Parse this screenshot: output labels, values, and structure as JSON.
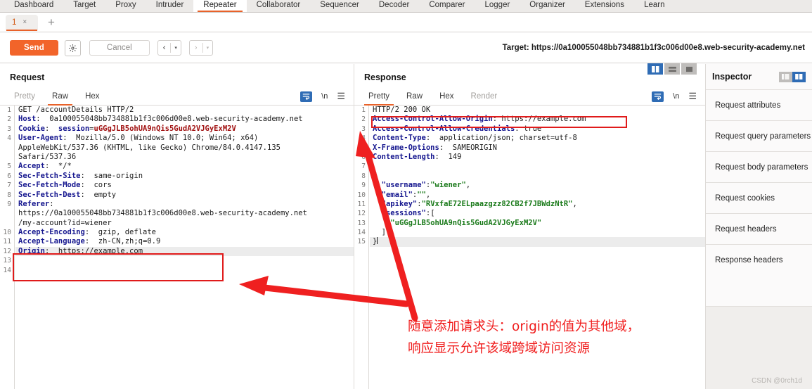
{
  "main_tabs": [
    {
      "label": "Dashboard",
      "active": false
    },
    {
      "label": "Target",
      "active": false
    },
    {
      "label": "Proxy",
      "active": false
    },
    {
      "label": "Intruder",
      "active": false
    },
    {
      "label": "Repeater",
      "active": true
    },
    {
      "label": "Collaborator",
      "active": false
    },
    {
      "label": "Sequencer",
      "active": false
    },
    {
      "label": "Decoder",
      "active": false
    },
    {
      "label": "Comparer",
      "active": false
    },
    {
      "label": "Logger",
      "active": false
    },
    {
      "label": "Organizer",
      "active": false
    },
    {
      "label": "Extensions",
      "active": false
    },
    {
      "label": "Learn",
      "active": false
    }
  ],
  "repeater_tabs": {
    "tab_number": "1",
    "close_glyph": "×",
    "add_glyph": "+"
  },
  "toolbar": {
    "send_label": "Send",
    "cancel_label": "Cancel",
    "gear_icon": "gear-icon",
    "prev_glyph": "‹",
    "next_glyph": "›",
    "caret_glyph": "▾",
    "target_label": "Target: https://0a100055048bb734881b1f3c006d00e8.web-security-academy.net"
  },
  "request": {
    "title": "Request",
    "tabs": [
      {
        "label": "Pretty",
        "active": false,
        "muted": true
      },
      {
        "label": "Raw",
        "active": true,
        "muted": false
      },
      {
        "label": "Hex",
        "active": false,
        "muted": false
      }
    ],
    "actions": {
      "wrap_icon": "wrap-lines-icon",
      "newline_label": "\\n",
      "menu_icon": "hamburger-menu-icon"
    },
    "line_numbers": [
      "1",
      "2",
      "3",
      "4",
      "",
      "",
      "5",
      "6",
      "7",
      "8",
      "9",
      "",
      "",
      "10",
      "11",
      "12",
      "13",
      "14"
    ],
    "lines": [
      {
        "n": 1,
        "parts": [
          {
            "t": "GET /accountDetails HTTP/2",
            "c": "val"
          }
        ]
      },
      {
        "n": 2,
        "parts": [
          {
            "t": "Host",
            "c": "hdr"
          },
          {
            "t": ":  0a100055048bb734881b1f3c006d00e8.web-security-academy.net",
            "c": "val"
          }
        ]
      },
      {
        "n": 3,
        "parts": [
          {
            "t": "Cookie",
            "c": "hdr"
          },
          {
            "t": ":  ",
            "c": "val"
          },
          {
            "t": "session",
            "c": "hdr"
          },
          {
            "t": "=",
            "c": "val"
          },
          {
            "t": "uGGgJLB5ohUA9nQis5GudA2VJGyExM2V",
            "c": "red"
          }
        ]
      },
      {
        "n": 4,
        "parts": [
          {
            "t": "User-Agent",
            "c": "hdr"
          },
          {
            "t": ":  Mozilla/5.0 (Windows NT 10.0; Win64; x64)",
            "c": "val"
          }
        ]
      },
      {
        "n": 0,
        "parts": [
          {
            "t": "AppleWebKit/537.36 (KHTML, like Gecko) Chrome/84.0.4147.135",
            "c": "val"
          }
        ]
      },
      {
        "n": 0,
        "parts": [
          {
            "t": "Safari/537.36",
            "c": "val"
          }
        ]
      },
      {
        "n": 5,
        "parts": [
          {
            "t": "Accept",
            "c": "hdr"
          },
          {
            "t": ":  */*",
            "c": "val"
          }
        ]
      },
      {
        "n": 6,
        "parts": [
          {
            "t": "Sec-Fetch-Site",
            "c": "hdr"
          },
          {
            "t": ":  same-origin",
            "c": "val"
          }
        ]
      },
      {
        "n": 7,
        "parts": [
          {
            "t": "Sec-Fetch-Mode",
            "c": "hdr"
          },
          {
            "t": ":  cors",
            "c": "val"
          }
        ]
      },
      {
        "n": 8,
        "parts": [
          {
            "t": "Sec-Fetch-Dest",
            "c": "hdr"
          },
          {
            "t": ":  empty",
            "c": "val"
          }
        ]
      },
      {
        "n": 9,
        "parts": [
          {
            "t": "Referer",
            "c": "hdr"
          },
          {
            "t": ":",
            "c": "val"
          }
        ]
      },
      {
        "n": 0,
        "parts": [
          {
            "t": "https://0a100055048bb734881b1f3c006d00e8.web-security-academy.net",
            "c": "val"
          }
        ]
      },
      {
        "n": 0,
        "parts": [
          {
            "t": "/my-account?id=wiener",
            "c": "val"
          }
        ]
      },
      {
        "n": 10,
        "parts": [
          {
            "t": "Accept-Encoding",
            "c": "hdr"
          },
          {
            "t": ":  gzip, deflate",
            "c": "val"
          }
        ]
      },
      {
        "n": 11,
        "parts": [
          {
            "t": "Accept-Language",
            "c": "hdr"
          },
          {
            "t": ":  zh-CN,zh;q=0.9",
            "c": "val"
          }
        ]
      },
      {
        "n": 12,
        "hl": true,
        "parts": [
          {
            "t": "Origin",
            "c": "hdr"
          },
          {
            "t": ":  https://example.com",
            "c": "val"
          }
        ]
      },
      {
        "n": 13,
        "parts": [
          {
            "t": "",
            "c": "val"
          }
        ]
      },
      {
        "n": 14,
        "parts": [
          {
            "t": "",
            "c": "val"
          }
        ]
      }
    ]
  },
  "response": {
    "title": "Response",
    "tabs": [
      {
        "label": "Pretty",
        "active": true,
        "muted": false
      },
      {
        "label": "Raw",
        "active": false,
        "muted": false
      },
      {
        "label": "Hex",
        "active": false,
        "muted": false
      },
      {
        "label": "Render",
        "active": false,
        "muted": true
      }
    ],
    "actions": {
      "wrap_icon": "wrap-lines-icon",
      "newline_label": "\\n",
      "menu_icon": "hamburger-menu-icon"
    },
    "layout_buttons": [
      "split-vertical-layout-icon",
      "split-horizontal-layout-icon",
      "single-pane-layout-icon"
    ],
    "lines": [
      {
        "n": 1,
        "parts": [
          {
            "t": "HTTP/2 200 OK",
            "c": "val"
          }
        ]
      },
      {
        "n": 2,
        "parts": [
          {
            "t": "Access-Control-Allow-Origin",
            "c": "hdr"
          },
          {
            "t": ": https://example.com",
            "c": "val"
          }
        ]
      },
      {
        "n": 3,
        "parts": [
          {
            "t": "Access-Control-Allow-Credentials",
            "c": "hdr"
          },
          {
            "t": ": true",
            "c": "val"
          }
        ]
      },
      {
        "n": 4,
        "parts": [
          {
            "t": "Content-Type",
            "c": "hdr"
          },
          {
            "t": ":  application/json; charset=utf-8",
            "c": "val"
          }
        ]
      },
      {
        "n": 5,
        "parts": [
          {
            "t": "X-Frame-Options",
            "c": "hdr"
          },
          {
            "t": ":  SAMEORIGIN",
            "c": "val"
          }
        ]
      },
      {
        "n": 6,
        "parts": [
          {
            "t": "Content-Length",
            "c": "hdr"
          },
          {
            "t": ":  149",
            "c": "val"
          }
        ]
      },
      {
        "n": 7,
        "parts": [
          {
            "t": "",
            "c": "val"
          }
        ]
      },
      {
        "n": 8,
        "parts": [
          {
            "t": "{",
            "c": "val"
          }
        ]
      },
      {
        "n": 9,
        "parts": [
          {
            "t": "  ",
            "c": "val"
          },
          {
            "t": "\"username\"",
            "c": "key"
          },
          {
            "t": ":",
            "c": "val"
          },
          {
            "t": "\"wiener\"",
            "c": "str"
          },
          {
            "t": ",",
            "c": "val"
          }
        ]
      },
      {
        "n": 10,
        "parts": [
          {
            "t": "  ",
            "c": "val"
          },
          {
            "t": "\"email\"",
            "c": "key"
          },
          {
            "t": ":",
            "c": "val"
          },
          {
            "t": "\"\"",
            "c": "str"
          },
          {
            "t": ",",
            "c": "val"
          }
        ]
      },
      {
        "n": 11,
        "parts": [
          {
            "t": "  ",
            "c": "val"
          },
          {
            "t": "\"apikey\"",
            "c": "key"
          },
          {
            "t": ":",
            "c": "val"
          },
          {
            "t": "\"RVxfaE72ELpaazgzz82CB2f7JBWdzNtR\"",
            "c": "str"
          },
          {
            "t": ",",
            "c": "val"
          }
        ]
      },
      {
        "n": 12,
        "parts": [
          {
            "t": "  ",
            "c": "val"
          },
          {
            "t": "\"sessions\"",
            "c": "key"
          },
          {
            "t": ":[",
            "c": "val"
          }
        ]
      },
      {
        "n": 13,
        "parts": [
          {
            "t": "    ",
            "c": "val"
          },
          {
            "t": "\"uGGgJLB5ohUA9nQis5GudA2VJGyExM2V\"",
            "c": "str"
          }
        ]
      },
      {
        "n": 14,
        "parts": [
          {
            "t": "  ]",
            "c": "val"
          }
        ]
      },
      {
        "n": 15,
        "hl": true,
        "cursor": true,
        "parts": [
          {
            "t": "}",
            "c": "val"
          }
        ]
      }
    ]
  },
  "inspector": {
    "title": "Inspector",
    "toggle_collapsed_icon": "panel-collapse-icon",
    "toggle_expanded_icon": "panel-expand-icon",
    "rows": [
      "Request attributes",
      "Request query parameters",
      "Request body parameters",
      "Request cookies",
      "Request headers",
      "Response headers"
    ]
  },
  "annotations": {
    "line1": "随意添加请求头：origin的值为其他域，",
    "line2": "响应显示允许该域跨域访问资源",
    "color": "#f01c1c",
    "request_highlight_box": "origin-header-highlight-box",
    "response_highlight_box": "access-control-allow-origin-highlight-box",
    "arrow_to_request": "arrow-pointing-to-origin-header",
    "arrow_to_response": "arrow-pointing-to-allow-origin-header"
  },
  "watermark": "CSDN @0rch1d"
}
